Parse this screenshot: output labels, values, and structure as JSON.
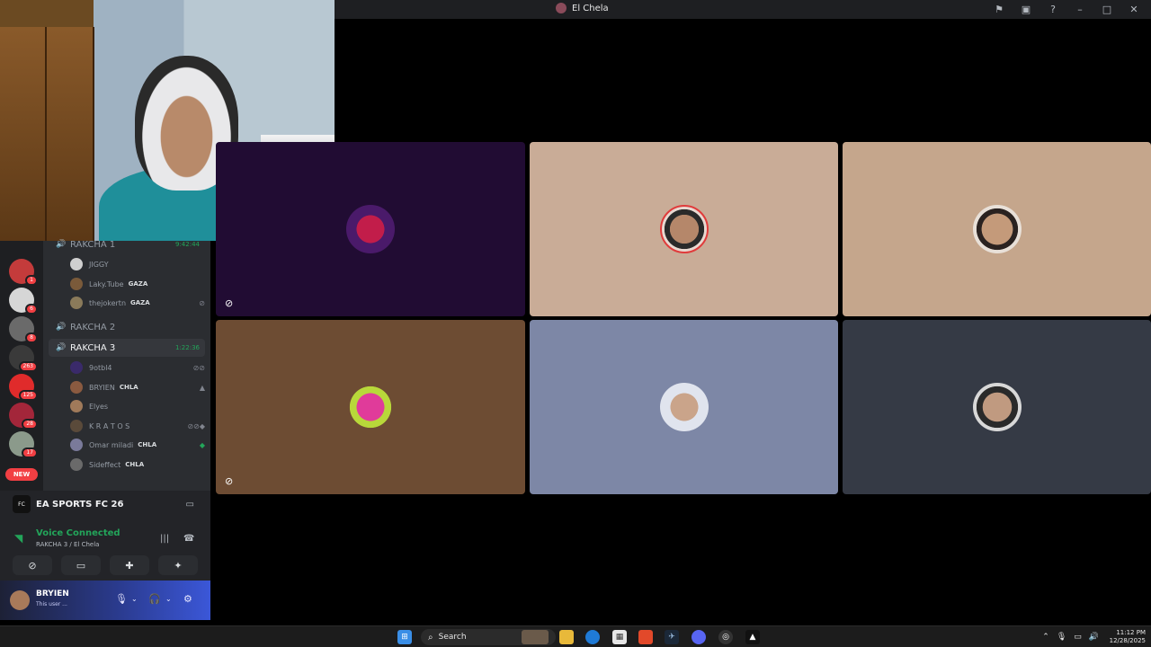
{
  "window": {
    "title": "El Chela"
  },
  "channels": [
    {
      "name": "RAKCHA 1",
      "timer": "9:42:44",
      "live": true,
      "active": false
    },
    {
      "name": "RAKCHA 2",
      "timer": "",
      "live": false,
      "active": false
    },
    {
      "name": "RAKCHA 3",
      "timer": "1:22:36",
      "live": true,
      "active": true
    }
  ],
  "members_rakcha1": [
    {
      "name": "JIGGY",
      "tag": ""
    },
    {
      "name": "Laky.Tube",
      "tag": "GAZA"
    },
    {
      "name": "thejokertn",
      "tag": "GAZA"
    }
  ],
  "members_rakcha3": [
    {
      "name": "9otbl4",
      "tag": ""
    },
    {
      "name": "BRYIEN",
      "tag": "CHLA"
    },
    {
      "name": "Elyes",
      "tag": ""
    },
    {
      "name": "K R A T O S",
      "tag": ""
    },
    {
      "name": "Omar miladi",
      "tag": "CHLA"
    },
    {
      "name": "Sideffect",
      "tag": "CHLA"
    }
  ],
  "server_badges": [
    "1",
    "6",
    "8",
    "263",
    "125",
    "28",
    "17"
  ],
  "new_label": "NEW",
  "activity": {
    "game": "EA SPORTS FC 26"
  },
  "voice": {
    "status": "Voice Connected",
    "location": "RAKCHA 3 / El Chela"
  },
  "user": {
    "name": "BRYIEN",
    "status": "This user ..."
  },
  "taskbar": {
    "search_placeholder": "Search",
    "time": "11:12 PM",
    "date": "12/28/2025"
  },
  "colors": {
    "accent_green": "#23a55a",
    "danger_red": "#f23f43",
    "panel_bg": "#2b2d31"
  }
}
